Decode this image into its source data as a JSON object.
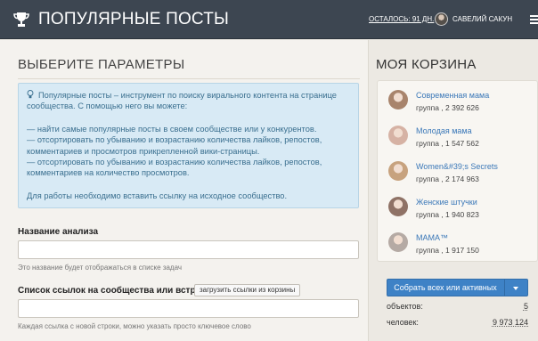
{
  "header": {
    "title": "ПОПУЛЯРНЫЕ ПОСТЫ",
    "days_left": "ОСТАЛОСЬ: 91 ДН.",
    "user_name": "САВЕЛИЙ САКУН",
    "trophy_icon": "trophy-icon",
    "more_icon": "more-icon"
  },
  "left": {
    "title": "ВЫБЕРИТЕ ПАРАМЕТРЫ",
    "info": {
      "intro": "Популярные посты – инструмент по поиску вирального контента на странице сообщества. С помощью него вы можете:",
      "items": [
        "— найти самые популярные посты в своем сообществе или у конкурентов.",
        "— отсортировать по убыванию и возрастанию количества лайков, репостов, комментариев и просмотров прикрепленной вики-страницы.",
        "— отсортировать по убыванию и возрастанию количества лайков, репостов, комментариев на количество просмотров."
      ],
      "note": "Для работы необходимо вставить ссылку на исходное сообщество."
    },
    "analysis_name": {
      "label": "Название анализа",
      "value": "",
      "hint": "Это название будет отображаться в списке задач"
    },
    "links": {
      "label": "Список ссылок на сообщества или встречи",
      "button": "загрузить ссылки из корзины",
      "value": "",
      "hint": "Каждая ссылка с новой строки, можно указать просто ключевое слово"
    }
  },
  "cart": {
    "title": "МОЯ КОРЗИНА",
    "items": [
      {
        "name": "Современная мама",
        "meta": "группа , 2 392 626",
        "avatar_color": "#a8846c"
      },
      {
        "name": "Молодая мама",
        "meta": "группа , 1 547 562",
        "avatar_color": "#d6b2a4"
      },
      {
        "name": "Women&#39;s Secrets",
        "meta": "группа , 2 174 963",
        "avatar_color": "#c7a27e"
      },
      {
        "name": "Женские штучки",
        "meta": "группа , 1 940 823",
        "avatar_color": "#8f7266"
      },
      {
        "name": "МАМА™",
        "meta": "группа , 1 917 150",
        "avatar_color": "#b5aaa4"
      }
    ],
    "collect_button": "Собрать всех или активных",
    "stats": {
      "objects_label": "объектов:",
      "objects_value": "5",
      "people_label": "человек:",
      "people_value": "9 973 124"
    }
  },
  "colors": {
    "topbar": "#3d4651",
    "link": "#3b78b8",
    "info_bg": "#d8eaf5",
    "button": "#3e82c6"
  }
}
